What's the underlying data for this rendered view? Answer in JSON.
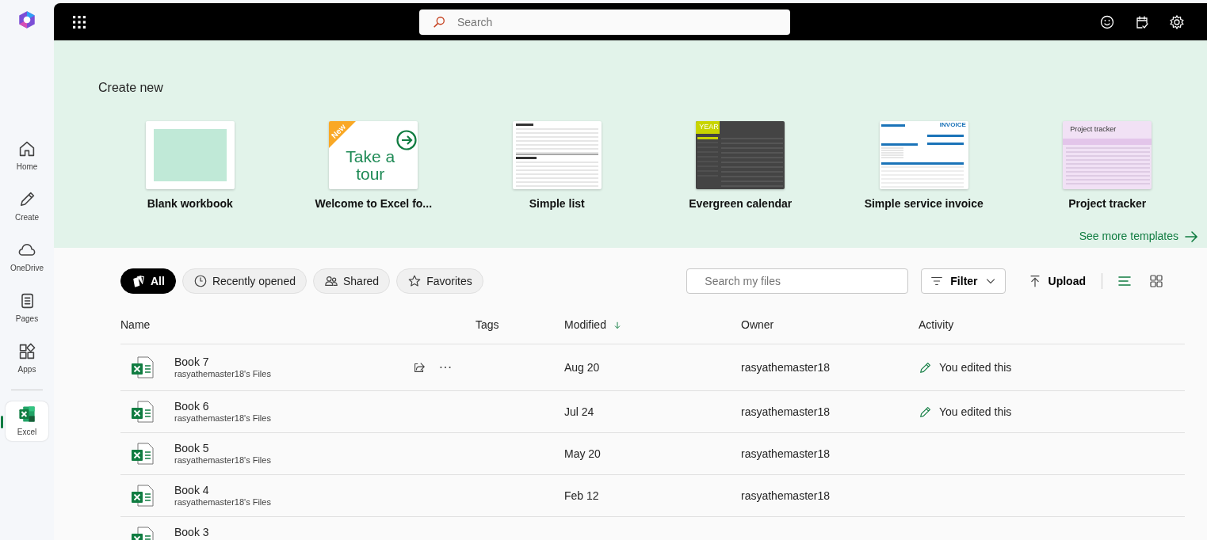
{
  "rail": [
    {
      "kind": "home",
      "label": "Home",
      "selected": false
    },
    {
      "kind": "create",
      "label": "Create",
      "selected": false
    },
    {
      "kind": "onedrive",
      "label": "OneDrive",
      "selected": false
    },
    {
      "kind": "pages",
      "label": "Pages",
      "selected": false
    },
    {
      "kind": "apps",
      "label": "Apps",
      "selected": false
    },
    {
      "kind": "excel",
      "label": "Excel",
      "selected": true
    }
  ],
  "topbar": {
    "search": {
      "placeholder": "Search"
    }
  },
  "create_new": {
    "title": "Create new",
    "templates": [
      {
        "kind": "blank",
        "label": "Blank workbook"
      },
      {
        "kind": "tour",
        "label": "Welcome to Excel fo...",
        "texts": [
          "New",
          "Take a tour"
        ]
      },
      {
        "kind": "list",
        "label": "Simple list"
      },
      {
        "kind": "calendar",
        "label": "Evergreen calendar",
        "texts": [
          "YEAR"
        ]
      },
      {
        "kind": "invoice",
        "label": "Simple service invoice",
        "texts": [
          "INVOICE"
        ]
      },
      {
        "kind": "tracker",
        "label": "Project tracker",
        "texts": [
          "Project tracker"
        ]
      }
    ],
    "more_link": "See more templates"
  },
  "filters": [
    {
      "kind": "all",
      "label": "All",
      "selected": true
    },
    {
      "kind": "recent",
      "label": "Recently opened",
      "selected": false
    },
    {
      "kind": "shared",
      "label": "Shared",
      "selected": false
    },
    {
      "kind": "favorites",
      "label": "Favorites",
      "selected": false
    }
  ],
  "toolbar": {
    "search": {
      "placeholder": "Search my files"
    },
    "filter": "Filter",
    "upload": "Upload",
    "views": [
      {
        "kind": "list",
        "selected": true
      },
      {
        "kind": "grid",
        "selected": false
      }
    ]
  },
  "table": {
    "columns": [
      {
        "label": "Name",
        "sorted": false
      },
      {
        "label": "Tags",
        "sorted": false
      },
      {
        "label": "Modified",
        "sorted": true
      },
      {
        "label": "Owner",
        "sorted": false
      },
      {
        "label": "Activity",
        "sorted": false
      }
    ],
    "rows": [
      {
        "name": "Book 7",
        "location": "rasyathemaster18's Files",
        "actions": true,
        "modified": "Aug 20",
        "owner": "rasyathemaster18",
        "activity": "You edited this"
      },
      {
        "name": "Book 6",
        "location": "rasyathemaster18's Files",
        "actions": false,
        "modified": "Jul 24",
        "owner": "rasyathemaster18",
        "activity": "You edited this"
      },
      {
        "name": "Book 5",
        "location": "rasyathemaster18's Files",
        "actions": false,
        "modified": "May 20",
        "owner": "rasyathemaster18"
      },
      {
        "name": "Book 4",
        "location": "rasyathemaster18's Files",
        "actions": false,
        "modified": "Feb 12",
        "owner": "rasyathemaster18"
      },
      {
        "name": "Book 3",
        "actions": false
      }
    ]
  }
}
